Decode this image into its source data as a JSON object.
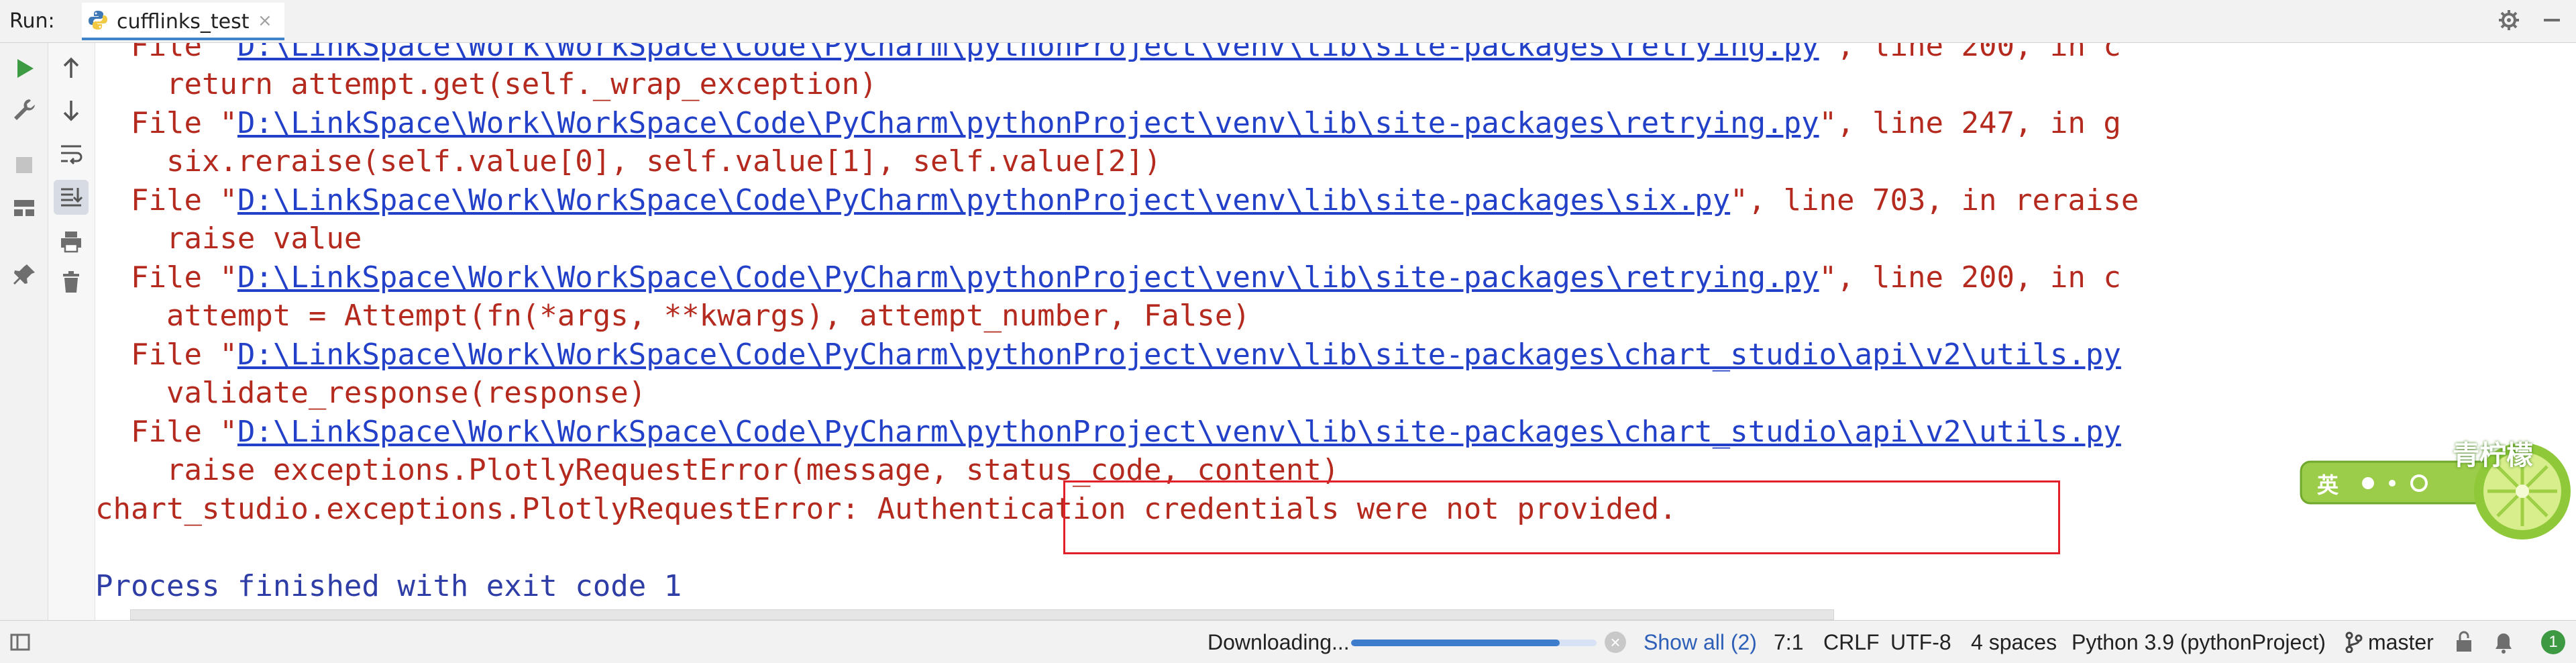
{
  "run_header": {
    "label": "Run:",
    "tab_title": "cufflinks_test",
    "icons": {
      "python": "python-file-icon",
      "close": "close-icon",
      "settings": "gear-icon",
      "minimize": "minimize-icon"
    }
  },
  "toolbar": {
    "left_icons": [
      "rerun-icon",
      "wrench-icon",
      "stop-icon",
      "layout-icon",
      "pin-icon"
    ],
    "right_icons": [
      "arrow-up-icon",
      "arrow-down-icon",
      "soft-wrap-icon",
      "scroll-to-end-icon",
      "print-icon",
      "trash-icon"
    ]
  },
  "console": {
    "lines": [
      {
        "prefix": "  File \"",
        "path": "D:\\LinkSpace\\Work\\WorkSpace\\Code\\PyCharm\\pythonProject\\venv\\lib\\site-packages\\retrying.py",
        "suffix": "\", line 200, in c"
      },
      {
        "text": "    return attempt.get(self._wrap_exception)"
      },
      {
        "prefix": "  File \"",
        "path": "D:\\LinkSpace\\Work\\WorkSpace\\Code\\PyCharm\\pythonProject\\venv\\lib\\site-packages\\retrying.py",
        "suffix": "\", line 247, in g"
      },
      {
        "text": "    six.reraise(self.value[0], self.value[1], self.value[2])"
      },
      {
        "prefix": "  File \"",
        "path": "D:\\LinkSpace\\Work\\WorkSpace\\Code\\PyCharm\\pythonProject\\venv\\lib\\site-packages\\six.py",
        "suffix": "\", line 703, in reraise"
      },
      {
        "text": "    raise value"
      },
      {
        "prefix": "  File \"",
        "path": "D:\\LinkSpace\\Work\\WorkSpace\\Code\\PyCharm\\pythonProject\\venv\\lib\\site-packages\\retrying.py",
        "suffix": "\", line 200, in c"
      },
      {
        "text": "    attempt = Attempt(fn(*args, **kwargs), attempt_number, False)"
      },
      {
        "prefix": "  File \"",
        "path": "D:\\LinkSpace\\Work\\WorkSpace\\Code\\PyCharm\\pythonProject\\venv\\lib\\site-packages\\chart_studio\\api\\v2\\utils.py",
        "suffix": ""
      },
      {
        "text": "    validate_response(response)"
      },
      {
        "prefix": "  File \"",
        "path": "D:\\LinkSpace\\Work\\WorkSpace\\Code\\PyCharm\\pythonProject\\venv\\lib\\site-packages\\chart_studio\\api\\v2\\utils.py",
        "suffix": ""
      },
      {
        "text": "    raise exceptions.PlotlyRequestError(message, status_code, content)"
      },
      {
        "text": "chart_studio.exceptions.PlotlyRequestError: Authentication credentials were not provided."
      },
      {
        "text": ""
      },
      {
        "text": "Process finished with exit code 1"
      }
    ]
  },
  "watermark": {
    "text": "青柠檬",
    "sub": "英"
  },
  "status_bar": {
    "downloading": "Downloading...",
    "progress": 0.85,
    "show_all": "Show all (2)",
    "position": "7:1",
    "line_sep": "CRLF",
    "encoding": "UTF-8",
    "indent": "4 spaces",
    "interpreter": "Python 3.9 (pythonProject)",
    "branch": "master",
    "notifications": "1"
  },
  "colors": {
    "error": "#b52a1e",
    "link": "#2340c8",
    "normal_output": "#2f3da6",
    "highlight_border": "#e0202a",
    "progress": "#3d7dcc"
  }
}
